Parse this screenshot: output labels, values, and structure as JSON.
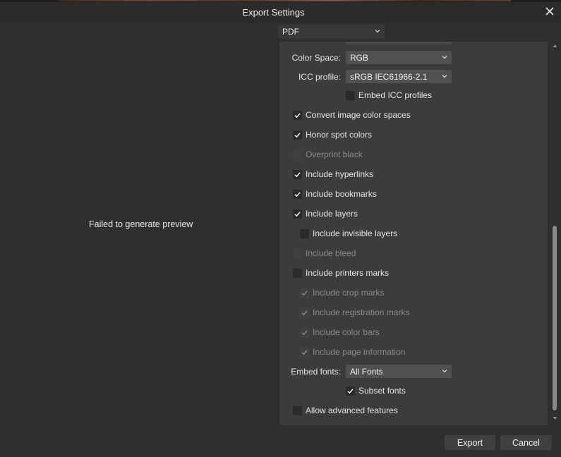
{
  "window": {
    "title": "Export Settings"
  },
  "format": {
    "value": "PDF"
  },
  "preview": {
    "message": "Failed to generate preview"
  },
  "settings": {
    "color_space": {
      "label": "Color Space:",
      "value": "RGB"
    },
    "icc_profile": {
      "label": "ICC profile:",
      "value": "sRGB IEC61966-2.1"
    },
    "embed_icc": {
      "label": "Embed ICC profiles",
      "checked": false
    },
    "checkboxes": [
      {
        "label": "Convert image color spaces",
        "checked": true,
        "disabled": false
      },
      {
        "label": "Honor spot colors",
        "checked": true,
        "disabled": false
      },
      {
        "label": "Overprint black",
        "checked": false,
        "disabled": true
      },
      {
        "label": "Include hyperlinks",
        "checked": true,
        "disabled": false
      },
      {
        "label": "Include bookmarks",
        "checked": true,
        "disabled": false
      },
      {
        "label": "Include layers",
        "checked": true,
        "disabled": false
      },
      {
        "label": "Include invisible layers",
        "checked": false,
        "disabled": false
      },
      {
        "label": "Include bleed",
        "checked": false,
        "disabled": true
      },
      {
        "label": "Include printers marks",
        "checked": false,
        "disabled": false
      },
      {
        "label": "Include crop marks",
        "checked": true,
        "disabled": true
      },
      {
        "label": "Include registration marks",
        "checked": true,
        "disabled": true
      },
      {
        "label": "Include color bars",
        "checked": true,
        "disabled": true
      },
      {
        "label": "Include page information",
        "checked": true,
        "disabled": true
      }
    ],
    "embed_fonts": {
      "label": "Embed fonts:",
      "value": "All Fonts"
    },
    "subset_fonts": {
      "label": "Subset fonts",
      "checked": true
    },
    "allow_advanced": {
      "label": "Allow advanced features",
      "checked": false
    }
  },
  "buttons": {
    "export": "Export",
    "cancel": "Cancel"
  },
  "icons": {
    "close": "close-icon",
    "chevron": "chevron-down-icon",
    "check": "checkmark-icon",
    "scroll_up": "scroll-up-arrow-icon",
    "scroll_down": "scroll-down-arrow-icon"
  }
}
